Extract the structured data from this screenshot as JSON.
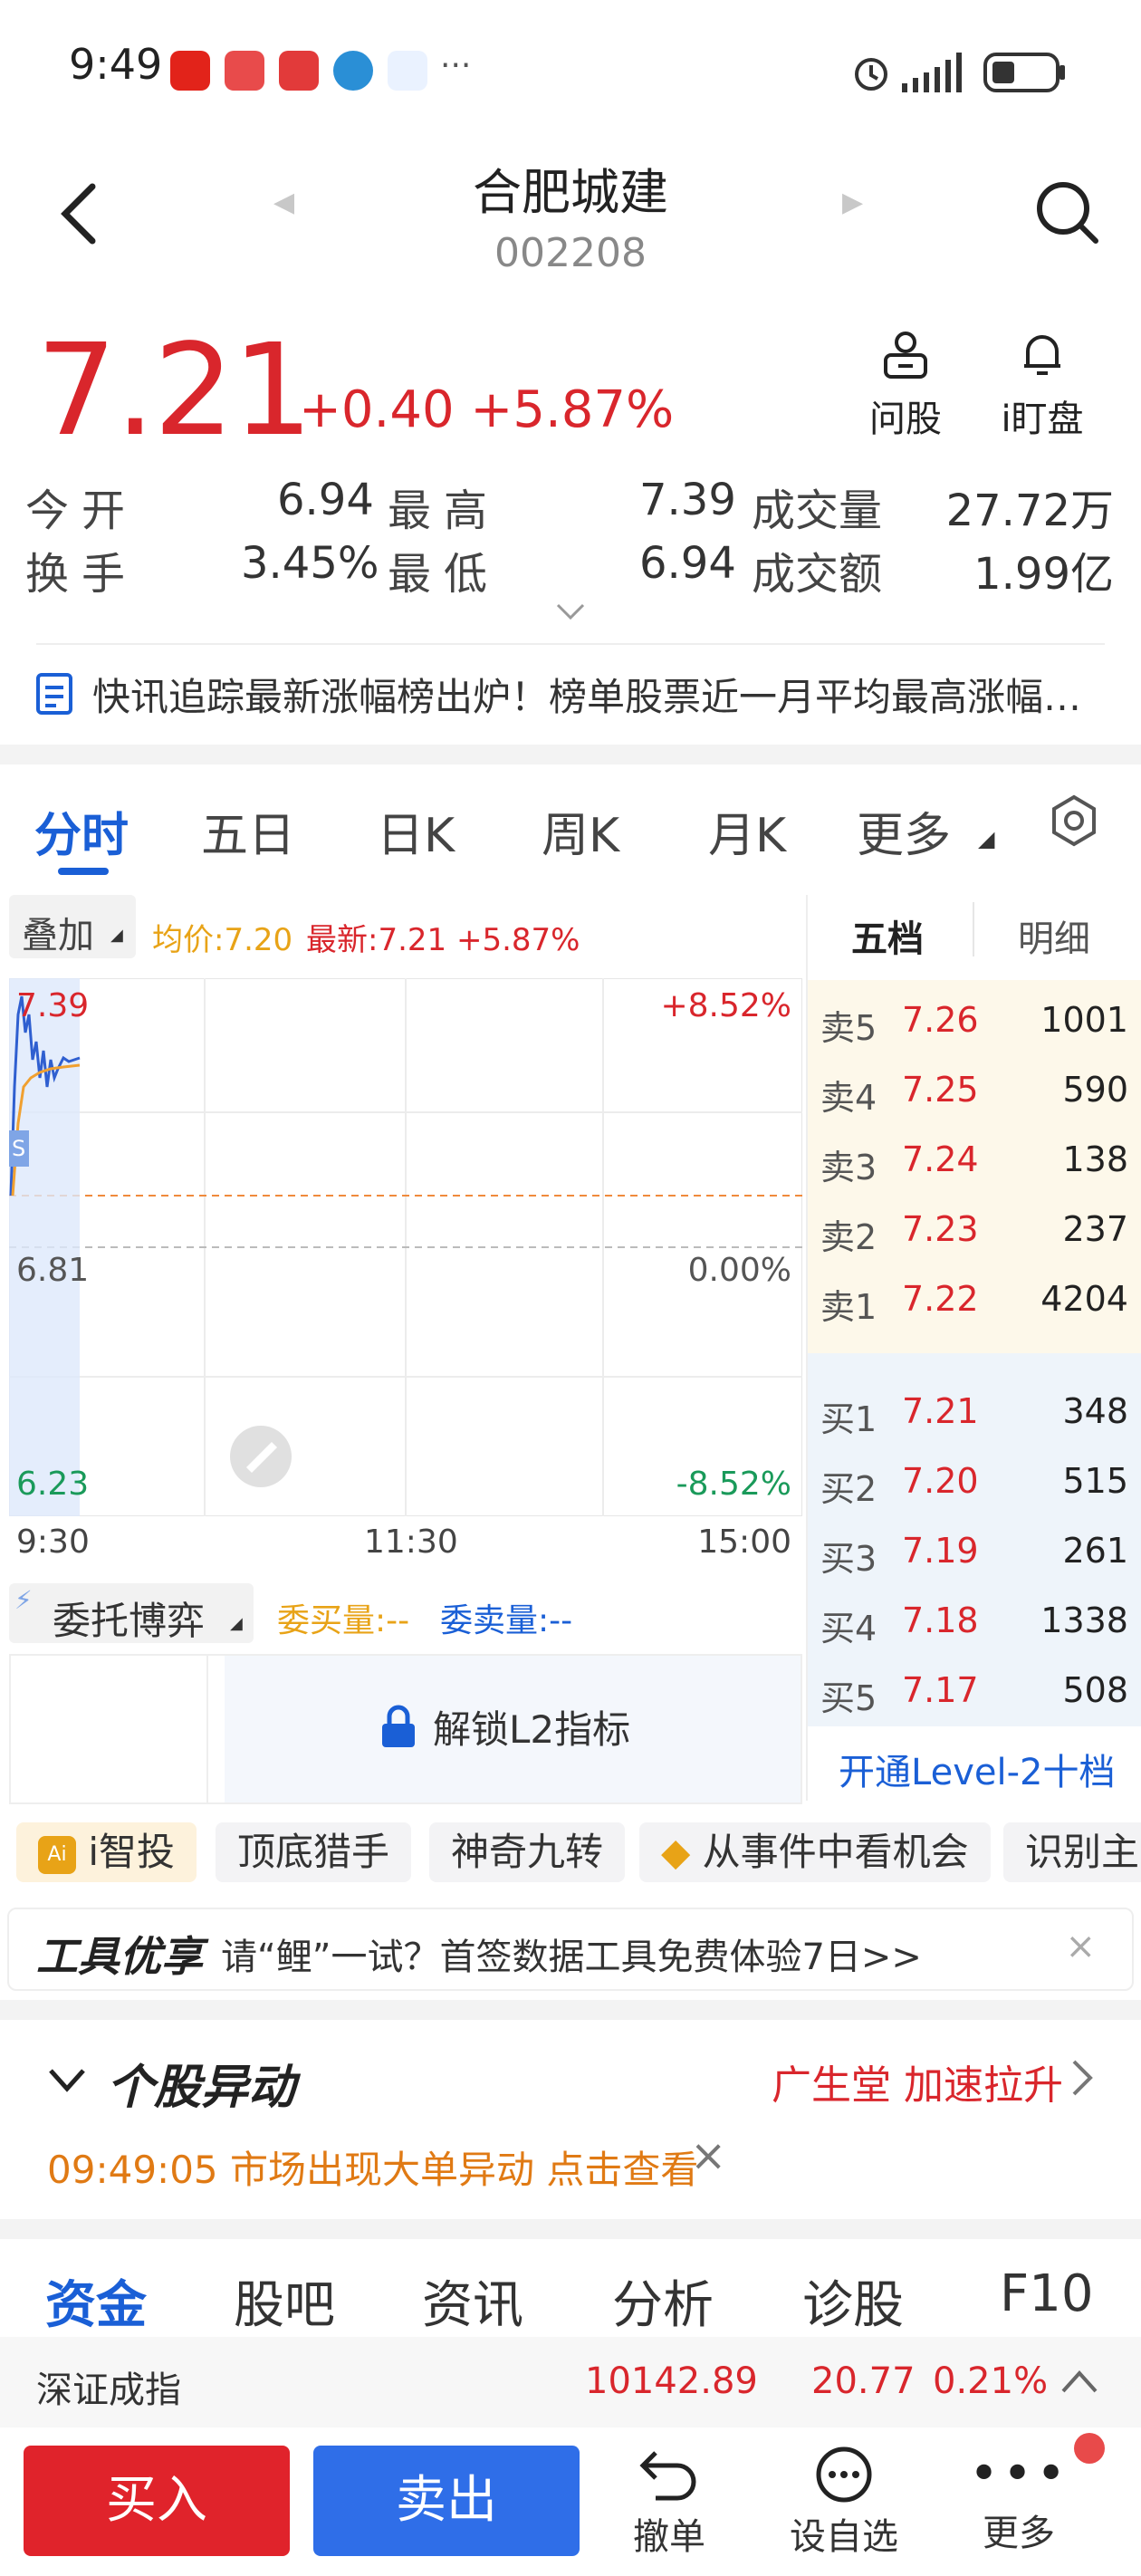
{
  "status_bar": {
    "time": "9:49",
    "more": "···"
  },
  "header": {
    "title": "合肥城建",
    "code": "002208"
  },
  "quote": {
    "price": "7.21",
    "change": "+0.40 +5.87%",
    "actions": [
      {
        "label": "问股",
        "icon": "person-chat-icon"
      },
      {
        "label": "i盯盘",
        "icon": "bell-icon"
      }
    ]
  },
  "stats": {
    "open_label": "今开",
    "open": "6.94",
    "high_label": "最高",
    "high": "7.39",
    "volume_label": "成交量",
    "volume": "27.72万",
    "turnover_label": "换手",
    "turnover": "3.45%",
    "low_label": "最低",
    "low": "6.94",
    "amount_label": "成交额",
    "amount": "1.99亿"
  },
  "news_ticker": "快讯追踪最新涨幅榜出炉！榜单股票近一月平均最高涨幅…",
  "chart_tabs": [
    "分时",
    "五日",
    "日K",
    "周K",
    "月K",
    "更多"
  ],
  "chart_info": {
    "overlay_label": "叠加",
    "avg_price": "均价:7.20",
    "latest": "最新:7.21 +5.87%",
    "y_top": "7.39",
    "y_mid": "6.81",
    "y_bottom": "6.23",
    "pct_top": "+8.52%",
    "pct_mid": "0.00%",
    "pct_bottom": "-8.52%",
    "x_start": "9:30",
    "x_mid": "11:30",
    "x_end": "15:00",
    "marker": "S"
  },
  "orderbook": {
    "tabs": [
      "五档",
      "明细"
    ],
    "asks": [
      {
        "label": "卖5",
        "price": "7.26",
        "qty": "1001"
      },
      {
        "label": "卖4",
        "price": "7.25",
        "qty": "590"
      },
      {
        "label": "卖3",
        "price": "7.24",
        "qty": "138"
      },
      {
        "label": "卖2",
        "price": "7.23",
        "qty": "237"
      },
      {
        "label": "卖1",
        "price": "7.22",
        "qty": "4204"
      }
    ],
    "bids": [
      {
        "label": "买1",
        "price": "7.21",
        "qty": "348"
      },
      {
        "label": "买2",
        "price": "7.20",
        "qty": "515"
      },
      {
        "label": "买3",
        "price": "7.19",
        "qty": "261"
      },
      {
        "label": "买4",
        "price": "7.18",
        "qty": "1338"
      },
      {
        "label": "买5",
        "price": "7.17",
        "qty": "508"
      }
    ],
    "level2_link": "开通Level-2十档"
  },
  "l2": {
    "title": "委托博弈",
    "buy_qty": "委买量:--",
    "sell_qty": "委卖量:--",
    "unlock": "解锁L2指标"
  },
  "feature_pills": [
    "i智投",
    "顶底猎手",
    "神奇九转",
    "从事件中看机会",
    "识别主"
  ],
  "tool_banner": {
    "brand": "工具优享",
    "text": "请“鲤”一试？首签数据工具免费体验7日>>"
  },
  "anomaly": {
    "title": "个股异动",
    "related": "广生堂 加速拉升",
    "alert": "09:49:05 市场出现大单异动 点击查看"
  },
  "footer_tabs": [
    "资金",
    "股吧",
    "资讯",
    "分析",
    "诊股",
    "F10"
  ],
  "index_bar": {
    "name": "深证成指",
    "value": "10142.89",
    "change": "20.77",
    "pct": "0.21%"
  },
  "bottom_bar": {
    "buy": "买入",
    "sell": "卖出",
    "cancel": "撤单",
    "watchlist": "设自选",
    "more": "更多"
  },
  "colors": {
    "up": "#d9262c",
    "down": "#1a9a5a",
    "accent": "#1a5fd6"
  }
}
